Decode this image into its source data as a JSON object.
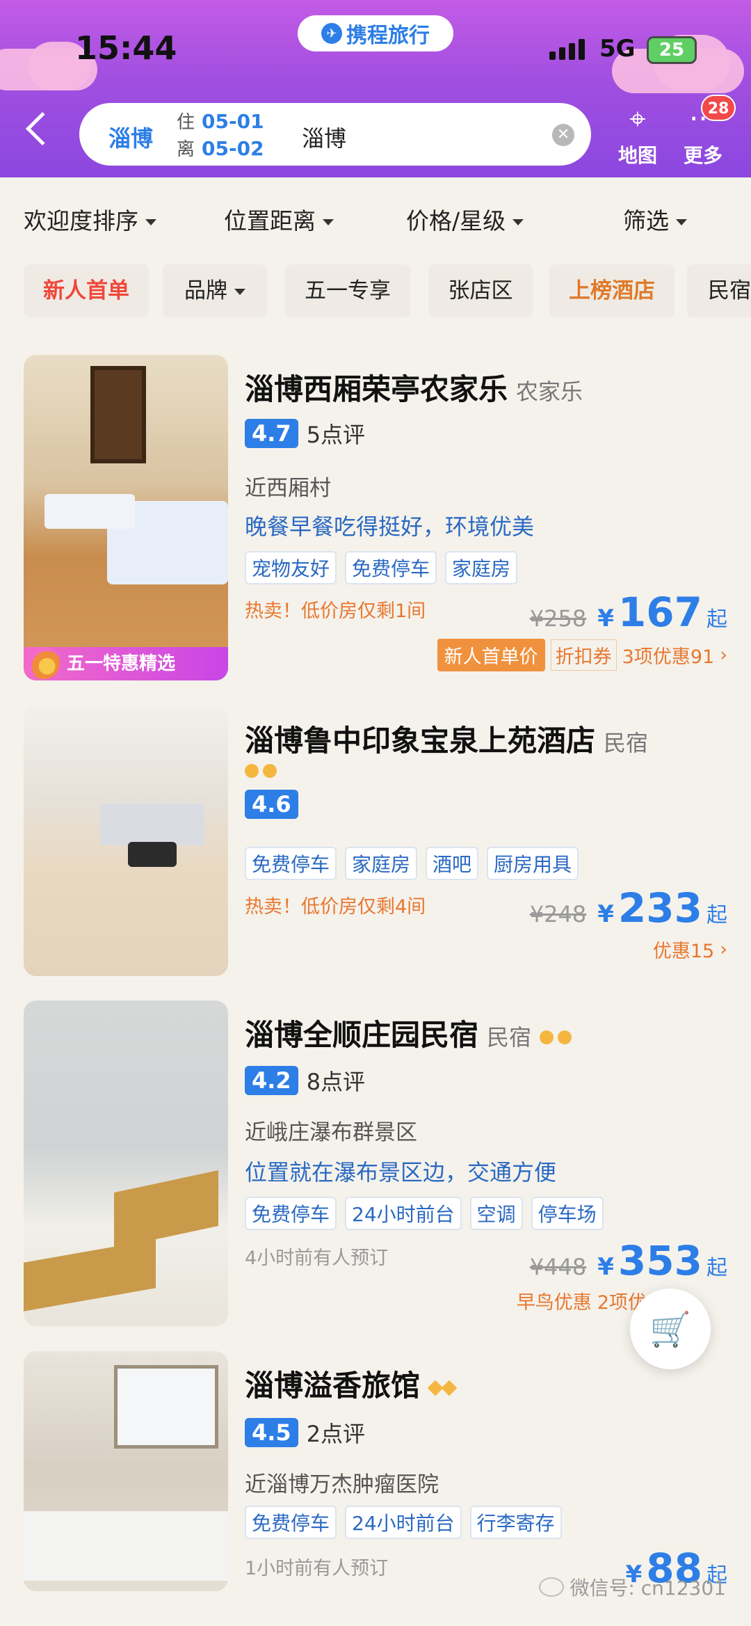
{
  "status": {
    "time": "15:44",
    "network": "5G",
    "battery": "25"
  },
  "brand": {
    "name": "携程旅行"
  },
  "search": {
    "city": "淄博",
    "checkin_label": "住",
    "checkin": "05-01",
    "checkout_label": "离",
    "checkout": "05-02",
    "keyword": "淄博"
  },
  "header_actions": {
    "map_label": "地图",
    "more_label": "更多",
    "more_badge": "28"
  },
  "sort": [
    {
      "label": "欢迎度排序"
    },
    {
      "label": "位置距离"
    },
    {
      "label": "价格/星级"
    },
    {
      "label": "筛选"
    }
  ],
  "chips": [
    {
      "label": "新人首单"
    },
    {
      "label": "品牌"
    },
    {
      "label": "五一专享"
    },
    {
      "label": "张店区"
    },
    {
      "label": "上榜酒店"
    },
    {
      "label": "民宿"
    }
  ],
  "hotels": [
    {
      "name": "淄博西厢荣亭农家乐",
      "type": "农家乐",
      "score": "4.7",
      "reviews": "5点评",
      "location": "近西厢村",
      "desc": "晚餐早餐吃得挺好，环境优美",
      "tags": [
        "宠物友好",
        "免费停车",
        "家庭房"
      ],
      "hot": "热卖！低价房仅剩1间",
      "old_price": "¥258",
      "currency": "¥",
      "price": "167",
      "suffix": "起",
      "promo_badge": "五一特惠精选",
      "deal": {
        "new_user": "新人首单价",
        "coupon": "折扣券",
        "offers": "3项优惠91"
      }
    },
    {
      "name": "淄博鲁中印象宝泉上苑酒店",
      "type": "民宿",
      "score": "4.6",
      "tags": [
        "免费停车",
        "家庭房",
        "酒吧",
        "厨房用具"
      ],
      "hot": "热卖！低价房仅剩4间",
      "old_price": "¥248",
      "currency": "¥",
      "price": "233",
      "suffix": "起",
      "deal": {
        "offers": "优惠15"
      }
    },
    {
      "name": "淄博全顺庄园民宿",
      "type": "民宿",
      "score": "4.2",
      "reviews": "8点评",
      "location": "近峨庄瀑布群景区",
      "desc": "位置就在瀑布景区边，交通方便",
      "tags": [
        "免费停车",
        "24小时前台",
        "空调",
        "停车场"
      ],
      "hot": "4小时前有人预订",
      "old_price": "¥448",
      "currency": "¥",
      "price": "353",
      "suffix": "起",
      "deal": {
        "early": "早鸟优惠",
        "offers": "2项优"
      }
    },
    {
      "name": "淄博溢香旅馆",
      "score": "4.5",
      "reviews": "2点评",
      "location": "近淄博万杰肿瘤医院",
      "tags": [
        "免费停车",
        "24小时前台",
        "行李寄存"
      ],
      "hot": "1小时前有人预订",
      "currency": "¥",
      "price": "88",
      "suffix": "起"
    }
  ],
  "watermark": "微信号: cn12301",
  "colors": {
    "accent": "#2d7ee6",
    "header": "#a14fe0",
    "warning": "#e8772f"
  }
}
